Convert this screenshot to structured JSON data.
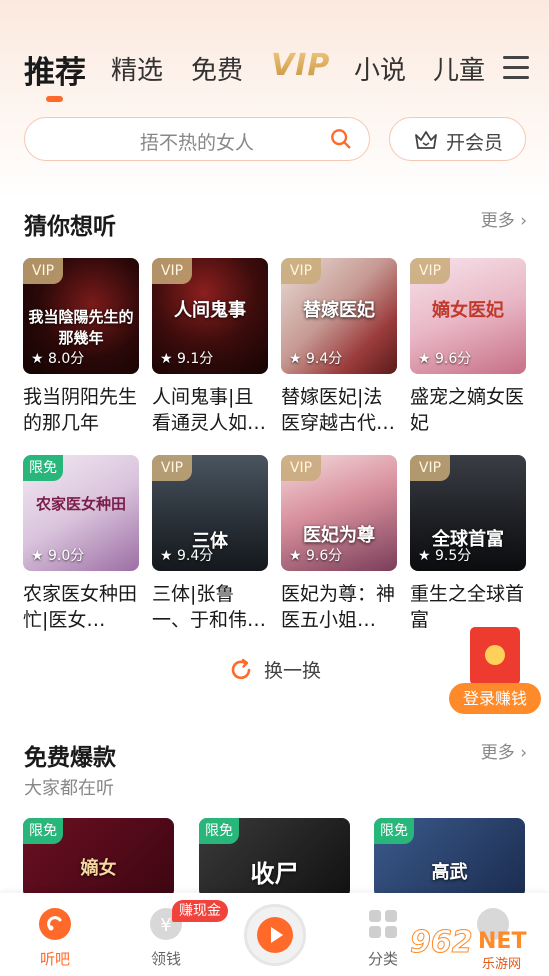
{
  "tabs": {
    "items": [
      "推荐",
      "精选",
      "免费",
      "VIP",
      "小说",
      "儿童"
    ]
  },
  "search": {
    "text": "捂不热的女人"
  },
  "vip_button": {
    "label": "开会员"
  },
  "guess": {
    "title": "猜你想听",
    "more": "更多 ›",
    "books": [
      {
        "badge": "VIP",
        "score": "★ 8.0分",
        "name": "我当阴阳先生的那几年",
        "cover": "我当陰陽先生的那幾年"
      },
      {
        "badge": "VIP",
        "score": "★ 9.1分",
        "name": "人间鬼事|且看通灵人如…",
        "cover": "人间鬼事"
      },
      {
        "badge": "VIP",
        "score": "★ 9.4分",
        "name": "替嫁医妃|法医穿越古代…",
        "cover": "替嫁医妃"
      },
      {
        "badge": "VIP",
        "score": "★ 9.6分",
        "name": "盛宠之嫡女医妃",
        "cover": "嫡女医妃"
      },
      {
        "badge": "限免",
        "score": "★ 9.0分",
        "name": "农家医女种田忙|医女…",
        "cover": "农家医女种田"
      },
      {
        "badge": "VIP",
        "score": "★ 9.4分",
        "name": "三体|张鲁一、于和伟…",
        "cover": "三体"
      },
      {
        "badge": "VIP",
        "score": "★ 9.6分",
        "name": "医妃为尊：神医五小姐…",
        "cover": "医妃为尊"
      },
      {
        "badge": "VIP",
        "score": "★ 9.5分",
        "name": "重生之全球首富",
        "cover": "全球首富"
      }
    ],
    "refresh": "换一换"
  },
  "float": {
    "earn": "登录赚钱"
  },
  "free": {
    "title": "免费爆款",
    "subtitle": "大家都在听",
    "more": "更多 ›",
    "cards": [
      {
        "badge": "限免",
        "cover": "嫡女"
      },
      {
        "badge": "限免",
        "cover": "收尸"
      },
      {
        "badge": "限免",
        "cover": "高武"
      }
    ]
  },
  "bottom_nav": {
    "items": [
      "听吧",
      "领钱",
      "",
      "分类",
      ""
    ],
    "hot_badge": "赚现金"
  },
  "watermark": {
    "num": "962",
    "net": "NET",
    "cn": "乐游网"
  },
  "colors": {
    "accent": "#ff6a2b",
    "free_badge": "#29b67b",
    "vip_gold": "#d9a85a"
  }
}
